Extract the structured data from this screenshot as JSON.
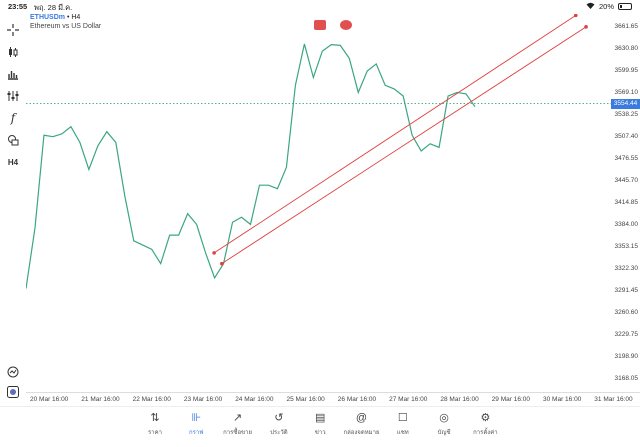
{
  "status_bar": {
    "time": "23:55",
    "date": "พฤ. 28 มี.ค.",
    "battery_text": "20%",
    "battery_level": 0.2
  },
  "symbol": {
    "name": "ETHUSDm",
    "separator": "•",
    "timeframe": "H4",
    "description": "Ethereum vs US Dollar"
  },
  "toolbar": {
    "timeframe_label": "H4",
    "items": [
      "crosshair-icon",
      "candles-icon",
      "bars-icon",
      "indicators-icon",
      "function-icon",
      "objects-icon",
      "timeframe-label"
    ]
  },
  "current_price": "3554.44",
  "price_levels": [
    "3661.65",
    "3630.80",
    "3599.95",
    "3569.10",
    "3538.25",
    "3507.40",
    "3476.55",
    "3445.70",
    "3414.85",
    "3384.00",
    "3353.15",
    "3322.30",
    "3291.45",
    "3260.60",
    "3229.75",
    "3198.90",
    "3168.05"
  ],
  "time_labels": [
    "20 Mar 16:00",
    "21 Mar 16:00",
    "22 Mar 16:00",
    "23 Mar 16:00",
    "24 Mar 16:00",
    "25 Mar 16:00",
    "26 Mar 16:00",
    "27 Mar 16:00",
    "28 Mar 16:00",
    "29 Mar 16:00",
    "30 Mar 16:00",
    "31 Mar 16:00"
  ],
  "colors": {
    "line": "#3aa682",
    "trendline": "#e04040",
    "accent": "#3a7be0",
    "price_line": "#3aa682"
  },
  "chart_data": {
    "type": "line",
    "series": [
      {
        "values": [
          3295,
          3380,
          3510,
          3508,
          3512,
          3522,
          3500,
          3462,
          3495,
          3515,
          3500,
          3425,
          3362,
          3356,
          3350,
          3330,
          3370,
          3370,
          3400,
          3385,
          3345,
          3310,
          3330,
          3388,
          3395,
          3385,
          3440,
          3440,
          3435,
          3465,
          3580,
          3638,
          3591,
          3628,
          3637,
          3636,
          3618,
          3570,
          3600,
          3610,
          3580,
          3575,
          3565,
          3510,
          3488,
          3498,
          3493,
          3565,
          3570,
          3568,
          3550
        ]
      }
    ],
    "trendlines": [
      {
        "start": [
          3.55,
          3345
        ],
        "end": [
          10.6,
          3678
        ]
      },
      {
        "start": [
          3.7,
          3330
        ],
        "end": [
          10.8,
          3662
        ]
      }
    ],
    "ylim": [
      3150,
      3680
    ],
    "xlabel": "",
    "ylabel": ""
  },
  "bottom_nav": [
    {
      "label": "ราคา",
      "icon": "quotes-icon"
    },
    {
      "label": "กราฟ",
      "icon": "chart-icon",
      "active": true
    },
    {
      "label": "การซื้อขาย",
      "icon": "trade-icon"
    },
    {
      "label": "ประวัติ",
      "icon": "history-icon"
    },
    {
      "label": "ข่าว",
      "icon": "news-icon"
    },
    {
      "label": "กล่องจดหมาย",
      "icon": "mailbox-icon"
    },
    {
      "label": "แชท",
      "icon": "chat-icon"
    },
    {
      "label": "บัญชี",
      "icon": "account-icon"
    },
    {
      "label": "การตั้งค่า",
      "icon": "settings-icon"
    }
  ]
}
